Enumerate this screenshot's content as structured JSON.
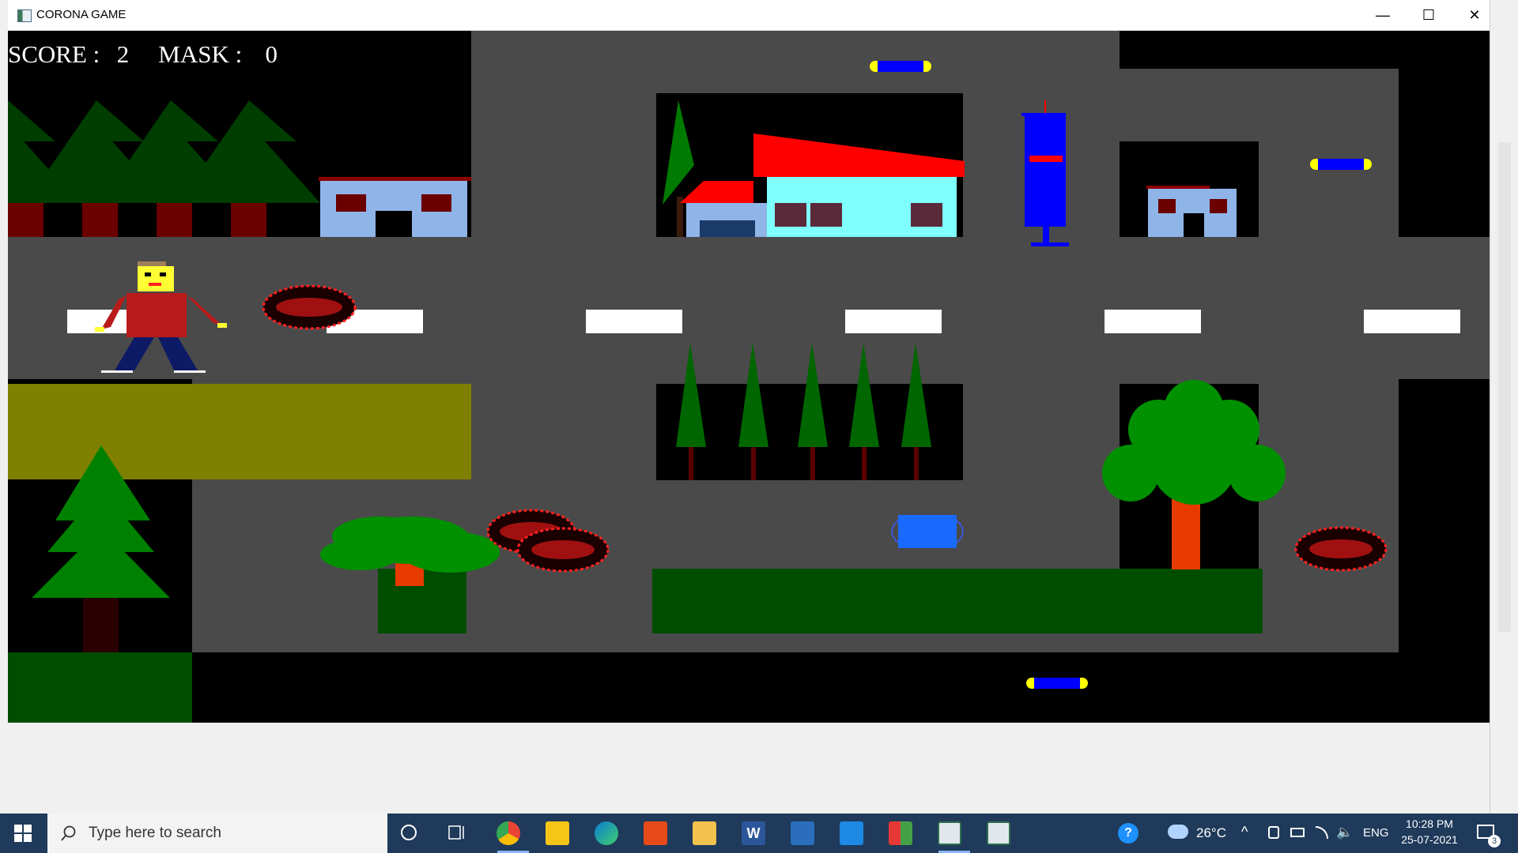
{
  "window": {
    "title": "CORONA GAME",
    "minimize": "—",
    "maximize": "☐",
    "close": "✕"
  },
  "hud": {
    "score_label": "SCORE :",
    "score": "2",
    "mask_label": "MASK :",
    "mask": "0"
  },
  "taskbar": {
    "search_placeholder": "Type here to search",
    "temperature": "26°C",
    "language": "ENG",
    "time": "10:28 PM",
    "date": "25-07-2021",
    "notifications": "3"
  },
  "colors": {
    "road": "#4a4a4a",
    "sky": "#000000",
    "grass": "#004d00",
    "olive": "#808000",
    "roof": "#ff0000"
  }
}
